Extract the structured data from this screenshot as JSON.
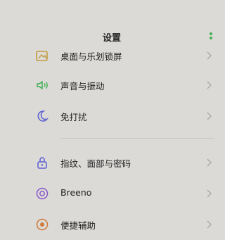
{
  "header": {
    "title": "设置",
    "more_icon": "more-dots-icon"
  },
  "items": [
    {
      "label": "桌面与乐划锁屏",
      "icon": "wallpaper-icon",
      "color": "#c39b3f"
    },
    {
      "label": "声音与振动",
      "icon": "speaker-icon",
      "color": "#3fae54"
    },
    {
      "label": "免打扰",
      "icon": "moon-icon",
      "color": "#5b5fd0"
    },
    {
      "label": "指纹、面部与密码",
      "icon": "lock-icon",
      "color": "#5b5fd0"
    },
    {
      "label": "Breeno",
      "icon": "breeno-icon",
      "color": "#8a5bc9"
    },
    {
      "label": "便捷辅助",
      "icon": "assist-icon",
      "color": "#d07a3a"
    }
  ],
  "accent": "#3fae54"
}
